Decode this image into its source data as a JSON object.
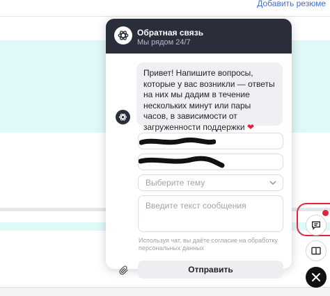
{
  "background": {
    "top_link": "Добавить резюме"
  },
  "widget": {
    "title": "Обратная связь",
    "subtitle": "Мы рядом 24/7",
    "logo_icon": "openai-knot-icon",
    "message_text": "Привет! Напишите вопросы, которые у вас возникли — ответы на них мы дадим в течение нескольких минут или пары часов, в зависимости от загруженности поддержки",
    "message_emoji": "❤",
    "form": {
      "name_value": "",
      "phone_value": "",
      "topic_placeholder": "Выберите тему",
      "message_placeholder": "Введите текст сообщения"
    },
    "consent_text": "Используя чат, вы даёте согласие на обработку персональных данных",
    "send_label": "Отправить"
  },
  "floating_buttons": {
    "chat_icon": "chat-bubble-icon",
    "book_icon": "book-icon",
    "close_icon": "close-icon"
  },
  "colors": {
    "header_bg": "#2a2d3a",
    "accent_red": "#e2233a",
    "background_band": "#dff8f8"
  }
}
